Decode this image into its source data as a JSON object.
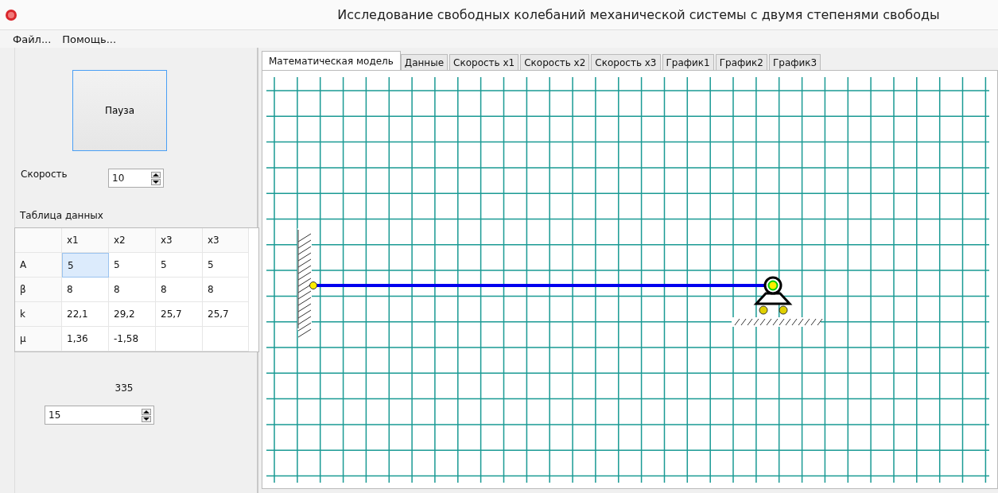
{
  "window": {
    "title": "Исследование свободных колебаний механической системы с двумя степенями свободы"
  },
  "menu": [
    {
      "label": "Файл..."
    },
    {
      "label": "Помощь..."
    }
  ],
  "controls": {
    "pause_button": "Пауза",
    "speed_label": "Скорость",
    "speed_value": "10",
    "table_title": "Таблица данных",
    "counter": "335",
    "step_value": "15"
  },
  "table": {
    "columns": [
      "x1",
      "x2",
      "x3",
      "x3"
    ],
    "rows": [
      {
        "label": "A",
        "cells": [
          {
            "text": "5",
            "selected": true
          },
          {
            "text": "5",
            "selected": false
          },
          {
            "text": "5",
            "selected": false
          },
          {
            "text": "5",
            "selected": false
          }
        ]
      },
      {
        "label": "β",
        "cells": [
          {
            "text": "8",
            "selected": false
          },
          {
            "text": "8",
            "selected": false
          },
          {
            "text": "8",
            "selected": false
          },
          {
            "text": "8",
            "selected": false
          }
        ]
      },
      {
        "label": "k",
        "cells": [
          {
            "text": "22,1",
            "selected": false
          },
          {
            "text": "29,2",
            "selected": false
          },
          {
            "text": "25,7",
            "selected": false
          },
          {
            "text": "25,7",
            "selected": false
          }
        ]
      },
      {
        "label": "μ",
        "cells": [
          {
            "text": "1,36",
            "selected": false
          },
          {
            "text": "-1,58",
            "selected": false
          },
          {
            "text": "",
            "selected": false
          },
          {
            "text": "",
            "selected": false
          }
        ]
      }
    ]
  },
  "tabs": [
    {
      "label": "Математическая модель",
      "selected": true
    },
    {
      "label": "Данные",
      "selected": false
    },
    {
      "label": "Скорость x1",
      "selected": false
    },
    {
      "label": "Скорость x2",
      "selected": false
    },
    {
      "label": "Скорость x3",
      "selected": false
    },
    {
      "label": "График1",
      "selected": false
    },
    {
      "label": "График2",
      "selected": false
    },
    {
      "label": "График3",
      "selected": false
    }
  ]
}
